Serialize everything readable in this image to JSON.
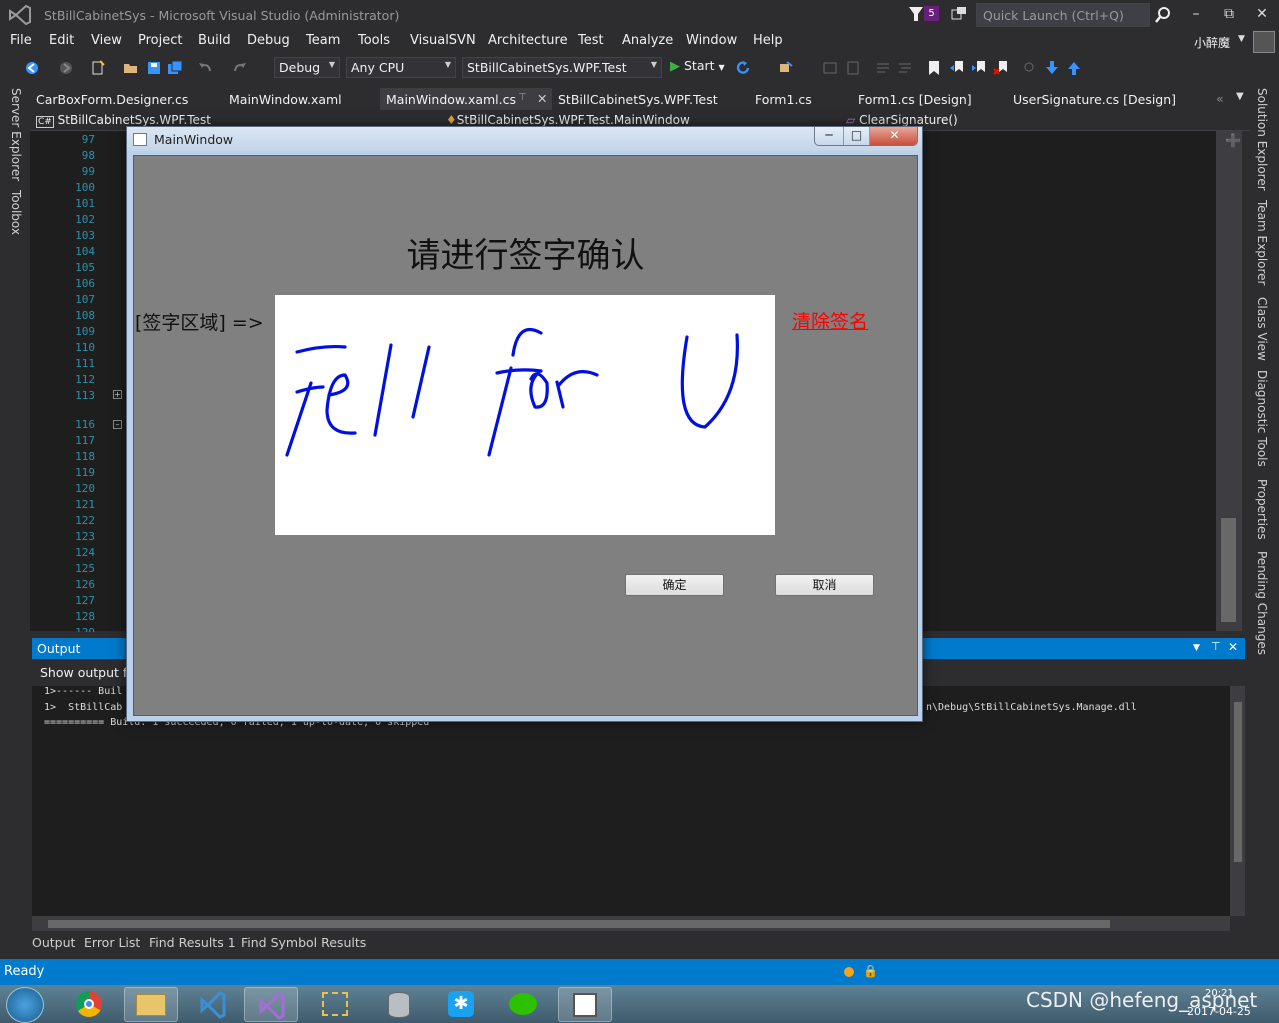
{
  "app": {
    "title": "StBillCabinetSys - Microsoft Visual Studio (Administrator)",
    "notification_count": "5",
    "quick_launch_placeholder": "Quick Launch (Ctrl+Q)",
    "user_name": "小醉魔"
  },
  "menu": [
    "File",
    "Edit",
    "View",
    "Project",
    "Build",
    "Debug",
    "Team",
    "Tools",
    "VisualSVN",
    "Architecture",
    "Test",
    "Analyze",
    "Window",
    "Help"
  ],
  "toolbar": {
    "configuration": "Debug",
    "platform": "Any CPU",
    "startup_project": "StBillCabinetSys.WPF.Test",
    "start_label": "Start"
  },
  "tabs": [
    "CarBoxForm.Designer.cs",
    "MainWindow.xaml",
    "MainWindow.xaml.cs",
    "StBillCabinetSys.WPF.Test",
    "Form1.cs",
    "Form1.cs [Design]",
    "UserSignature.cs [Design]"
  ],
  "navbar": {
    "project": "StBillCabinetSys.WPF.Test",
    "class": "StBillCabinetSys.WPF.Test.MainWindow",
    "member": "ClearSignature()"
  },
  "left_rail": [
    "Server Explorer",
    "Toolbox"
  ],
  "right_rail": [
    "Solution Explorer",
    "Team Explorer",
    "Class View",
    "Diagnostic Tools",
    "Properties",
    "Pending Changes"
  ],
  "line_numbers": [
    "97",
    "98",
    "99",
    "100",
    "101",
    "102",
    "103",
    "104",
    "105",
    "106",
    "107",
    "108",
    "109",
    "110",
    "111",
    "112",
    "113",
    "116",
    "117",
    "118",
    "119",
    "120",
    "121",
    "122",
    "123",
    "124",
    "125",
    "126",
    "127",
    "128",
    "129"
  ],
  "output": {
    "title": "Output",
    "source_label": "Show output fr",
    "lines": [
      "1>------ Buil",
      "1>  StBillCab",
      "========== Build: 1 succeeded, 0 failed, 1 up-to-date, 0 skipped",
      "n\\Debug\\StBillCabinetSys.Manage.dll"
    ]
  },
  "bottom_tabs": [
    "Output",
    "Error List",
    "Find Results 1",
    "Find Symbol Results"
  ],
  "status": "Ready",
  "taskbar": {
    "time": "20:21",
    "date": "2017-04-25",
    "watermark": "CSDN @hefeng_aspnet"
  },
  "wpf_window": {
    "title": "MainWindow",
    "heading": "请进行签字确认",
    "sign_label": "[签字区域] =>",
    "signature_text": "Fell for U",
    "clear_link": "清除签名",
    "ok_button": "确定",
    "cancel_button": "取消",
    "ink_color": "#0010e0"
  }
}
